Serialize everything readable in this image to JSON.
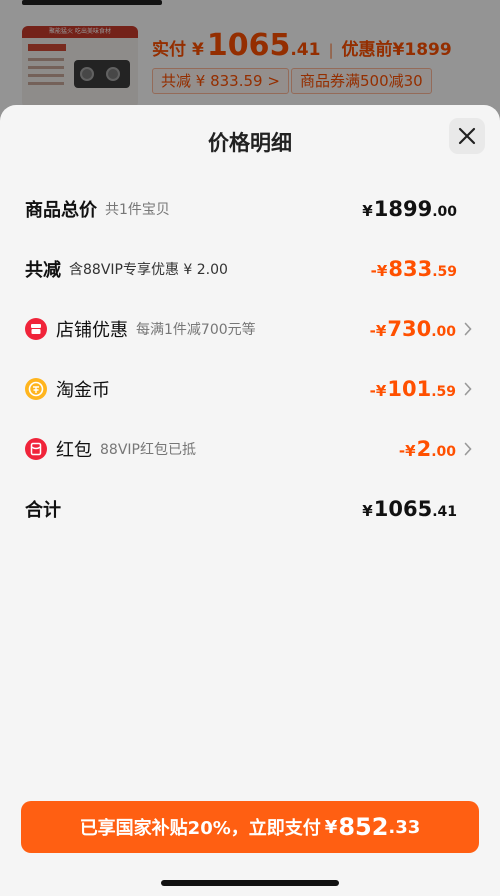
{
  "background": {
    "thumbnail_banner": "聚能猛火 吃出美味食材",
    "price_label": "实付",
    "price_yen": "¥",
    "price_int": "1065",
    "price_dec": ".41",
    "separator": "|",
    "original_price": "优惠前¥1899",
    "chips": [
      "共减 ¥ 833.59 >",
      "商品券满500减30"
    ]
  },
  "sheet": {
    "title": "价格明细",
    "rows": [
      {
        "label": "商品总价",
        "sub": "共1件宝贝",
        "yen": "¥",
        "int": "1899",
        "dec": ".00"
      },
      {
        "label": "共减",
        "sub": "含88VIP专享优惠 ¥ 2.00",
        "yen": "-¥",
        "int": "833",
        "dec": ".59"
      },
      {
        "label": "店铺优惠",
        "sub": "每满1件减700元等",
        "yen": "-¥",
        "int": "730",
        "dec": ".00",
        "icon": "shop-icon"
      },
      {
        "label": "淘金币",
        "sub": "",
        "yen": "-¥",
        "int": "101",
        "dec": ".59",
        "icon": "coin-icon"
      },
      {
        "label": "红包",
        "sub": "88VIP红包已抵",
        "yen": "-¥",
        "int": "2",
        "dec": ".00",
        "icon": "red-packet-icon"
      },
      {
        "label": "合计",
        "sub": "",
        "yen": "¥",
        "int": "1065",
        "dec": ".41"
      }
    ],
    "footer": {
      "text": "已享国家补贴20%，立即支付",
      "yen": "¥",
      "int": "852",
      "dec": ".33"
    }
  },
  "colors": {
    "accent": "#ff5000",
    "button": "#ff5f12",
    "sheet_bg": "#f5f5f5"
  }
}
